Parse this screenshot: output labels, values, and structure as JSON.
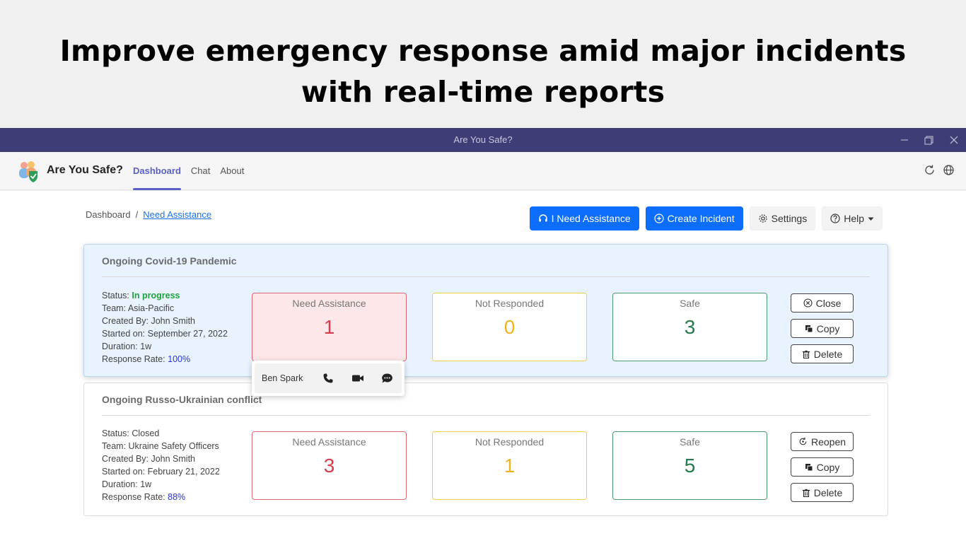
{
  "banner": {
    "line1": "Improve emergency response amid major incidents",
    "line2": "with real-time reports"
  },
  "window": {
    "title": "Are You Safe?"
  },
  "app": {
    "name": "Are You Safe?",
    "tabs": [
      {
        "label": "Dashboard",
        "active": true
      },
      {
        "label": "Chat",
        "active": false
      },
      {
        "label": "About",
        "active": false
      }
    ]
  },
  "breadcrumb": {
    "root": "Dashboard",
    "separator": "/",
    "current": "Need Assistance"
  },
  "toolbar": {
    "need_assistance": "I Need Assistance",
    "create_incident": "Create Incident",
    "settings": "Settings",
    "help": "Help"
  },
  "stat_labels": {
    "need_assistance": "Need Assistance",
    "not_responded": "Not Responded",
    "safe": "Safe"
  },
  "incidents": [
    {
      "title": "Ongoing Covid-19 Pandemic",
      "status_label": "Status:",
      "status": "In progress",
      "team": "Team: Asia-Pacific",
      "created_by": "Created By: John Smith",
      "started_on": "Started on: September 27, 2022",
      "duration": "Duration: 1w",
      "response_rate_label": "Response Rate:",
      "response_rate": "100%",
      "need_assistance": "1",
      "not_responded": "0",
      "safe": "3",
      "actions": [
        "Close",
        "Copy",
        "Delete"
      ]
    },
    {
      "title": "Ongoing Russo-Ukrainian conflict",
      "status_label": "Status:",
      "status": "Closed",
      "team": "Team: Ukraine Safety Officers",
      "created_by": "Created By: John Smith",
      "started_on": "Started on: February 21, 2022",
      "duration": "Duration: 1w",
      "response_rate_label": "Response Rate:",
      "response_rate": "88%",
      "need_assistance": "3",
      "not_responded": "1",
      "safe": "5",
      "actions": [
        "Reopen",
        "Copy",
        "Delete"
      ]
    }
  ],
  "popup": {
    "person": "Ben Spark"
  },
  "colors": {
    "primary": "#0d6efd",
    "teams_purple": "#5b5fc7",
    "titlebar": "#3f3d75",
    "need_assistance": "#d83b4b",
    "not_responded": "#f0b323",
    "safe": "#237b4b"
  }
}
